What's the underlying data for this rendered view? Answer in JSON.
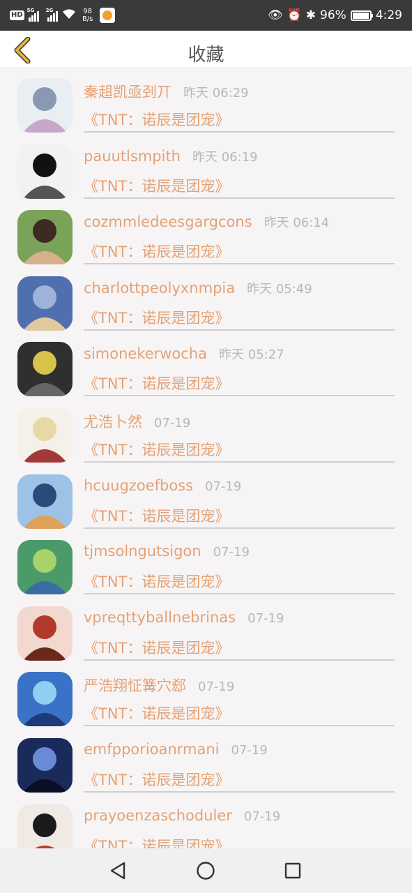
{
  "status_bar": {
    "hd": "HD",
    "sim1": "5G",
    "sim2": "2G",
    "speed_value": "98",
    "speed_unit": "B/s",
    "battery": "96%",
    "time": "4:29",
    "battery_level": 0.96
  },
  "header": {
    "title": "收藏"
  },
  "items": [
    {
      "name": "秦趄凯亟刭丌",
      "time": "昨天 06:29",
      "book": "《TNT：诺辰是团宠》",
      "avatar_colors": [
        "#e9eef2",
        "#8a98b3",
        "#c6a9c9"
      ]
    },
    {
      "name": "pauutlsmpith",
      "time": "昨天 06:19",
      "book": "《TNT：诺辰是团宠》",
      "avatar_colors": [
        "#f2f2f2",
        "#111111",
        "#555555"
      ]
    },
    {
      "name": "cozmmledeesgargcons",
      "time": "昨天 06:14",
      "book": "《TNT：诺辰是团宠》",
      "avatar_colors": [
        "#7aa35a",
        "#3d2a22",
        "#d9b08c"
      ]
    },
    {
      "name": "charlottpeolyxnmpia",
      "time": "昨天 05:49",
      "book": "《TNT：诺辰是团宠》",
      "avatar_colors": [
        "#4f6fae",
        "#9fb3d9",
        "#e0c9a0"
      ]
    },
    {
      "name": "simonekerwocha",
      "time": "昨天 05:27",
      "book": "《TNT：诺辰是团宠》",
      "avatar_colors": [
        "#2f2f2f",
        "#d8c34a",
        "#666666"
      ]
    },
    {
      "name": "尤浩卜然",
      "time": "07-19",
      "book": "《TNT：诺辰是团宠》",
      "avatar_colors": [
        "#f4f0ea",
        "#e7d9a6",
        "#a23a3a"
      ]
    },
    {
      "name": "hcuugzoefboss",
      "time": "07-19",
      "book": "《TNT：诺辰是团宠》",
      "avatar_colors": [
        "#9cc3e6",
        "#2a4a7a",
        "#e0a05a"
      ]
    },
    {
      "name": "tjmsolngutsigon",
      "time": "07-19",
      "book": "《TNT：诺辰是团宠》",
      "avatar_colors": [
        "#4b9a6a",
        "#a6d36a",
        "#3a6ea0"
      ]
    },
    {
      "name": "vpreqttyballnebrinas",
      "time": "07-19",
      "book": "《TNT：诺辰是团宠》",
      "avatar_colors": [
        "#f3d8cf",
        "#b23a2a",
        "#6a2a1a"
      ]
    },
    {
      "name": "严浩翔怔篝穴郄",
      "time": "07-19",
      "book": "《TNT：诺辰是团宠》",
      "avatar_colors": [
        "#3a72c8",
        "#8fd0f2",
        "#1d3a7a"
      ]
    },
    {
      "name": "emfpporioanrmani",
      "time": "07-19",
      "book": "《TNT：诺辰是团宠》",
      "avatar_colors": [
        "#1a2a5a",
        "#6a8ad8",
        "#0a0f25"
      ]
    },
    {
      "name": "prayoenzaschoduler",
      "time": "07-19",
      "book": "《TNT：诺辰是团宠》",
      "avatar_colors": [
        "#f1e9e4",
        "#1b1b1b",
        "#c0392b"
      ]
    }
  ],
  "nav": {
    "back_icon": "triangle-back-icon",
    "home_icon": "circle-home-icon",
    "recents_icon": "square-recents-icon"
  },
  "colors": {
    "accent": "#e3a275",
    "time": "#b8b8b8",
    "back_arrow": "#e8b530",
    "background": "#f7f4f5"
  }
}
